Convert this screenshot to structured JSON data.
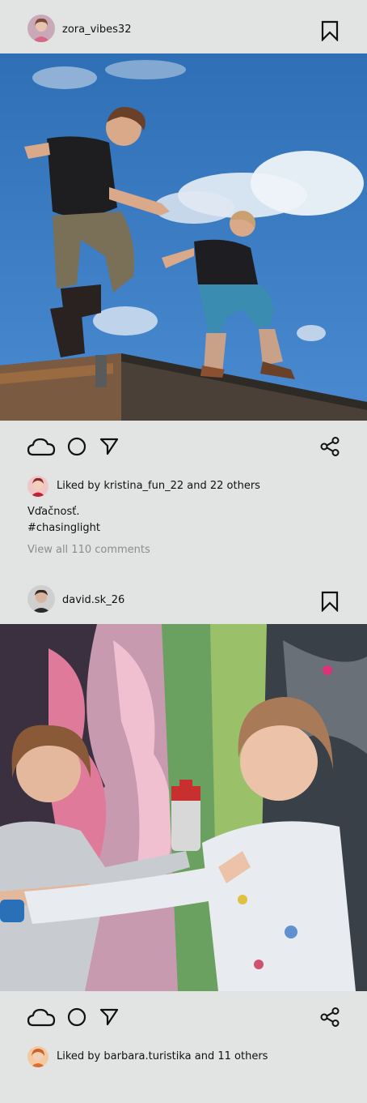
{
  "posts": [
    {
      "username": "zora_vibes32",
      "liked_by": "Liked by kristina_fun_22 and 22 others",
      "caption_line1": "Vďačnosť.",
      "caption_line2": "#chasinglight",
      "view_comments": "View all 110 comments"
    },
    {
      "username": "david.sk_26",
      "liked_by": "Liked by barbara.turistika and 11 others"
    }
  ],
  "icons": {
    "like": "cloud-icon",
    "comment": "circle-icon",
    "send": "send-icon",
    "share": "share-icon",
    "save": "bookmark-icon"
  },
  "colors": {
    "background": "#e2e4e3",
    "text": "#111111",
    "muted": "#8b8d8c",
    "sky": "#3a78c0"
  }
}
